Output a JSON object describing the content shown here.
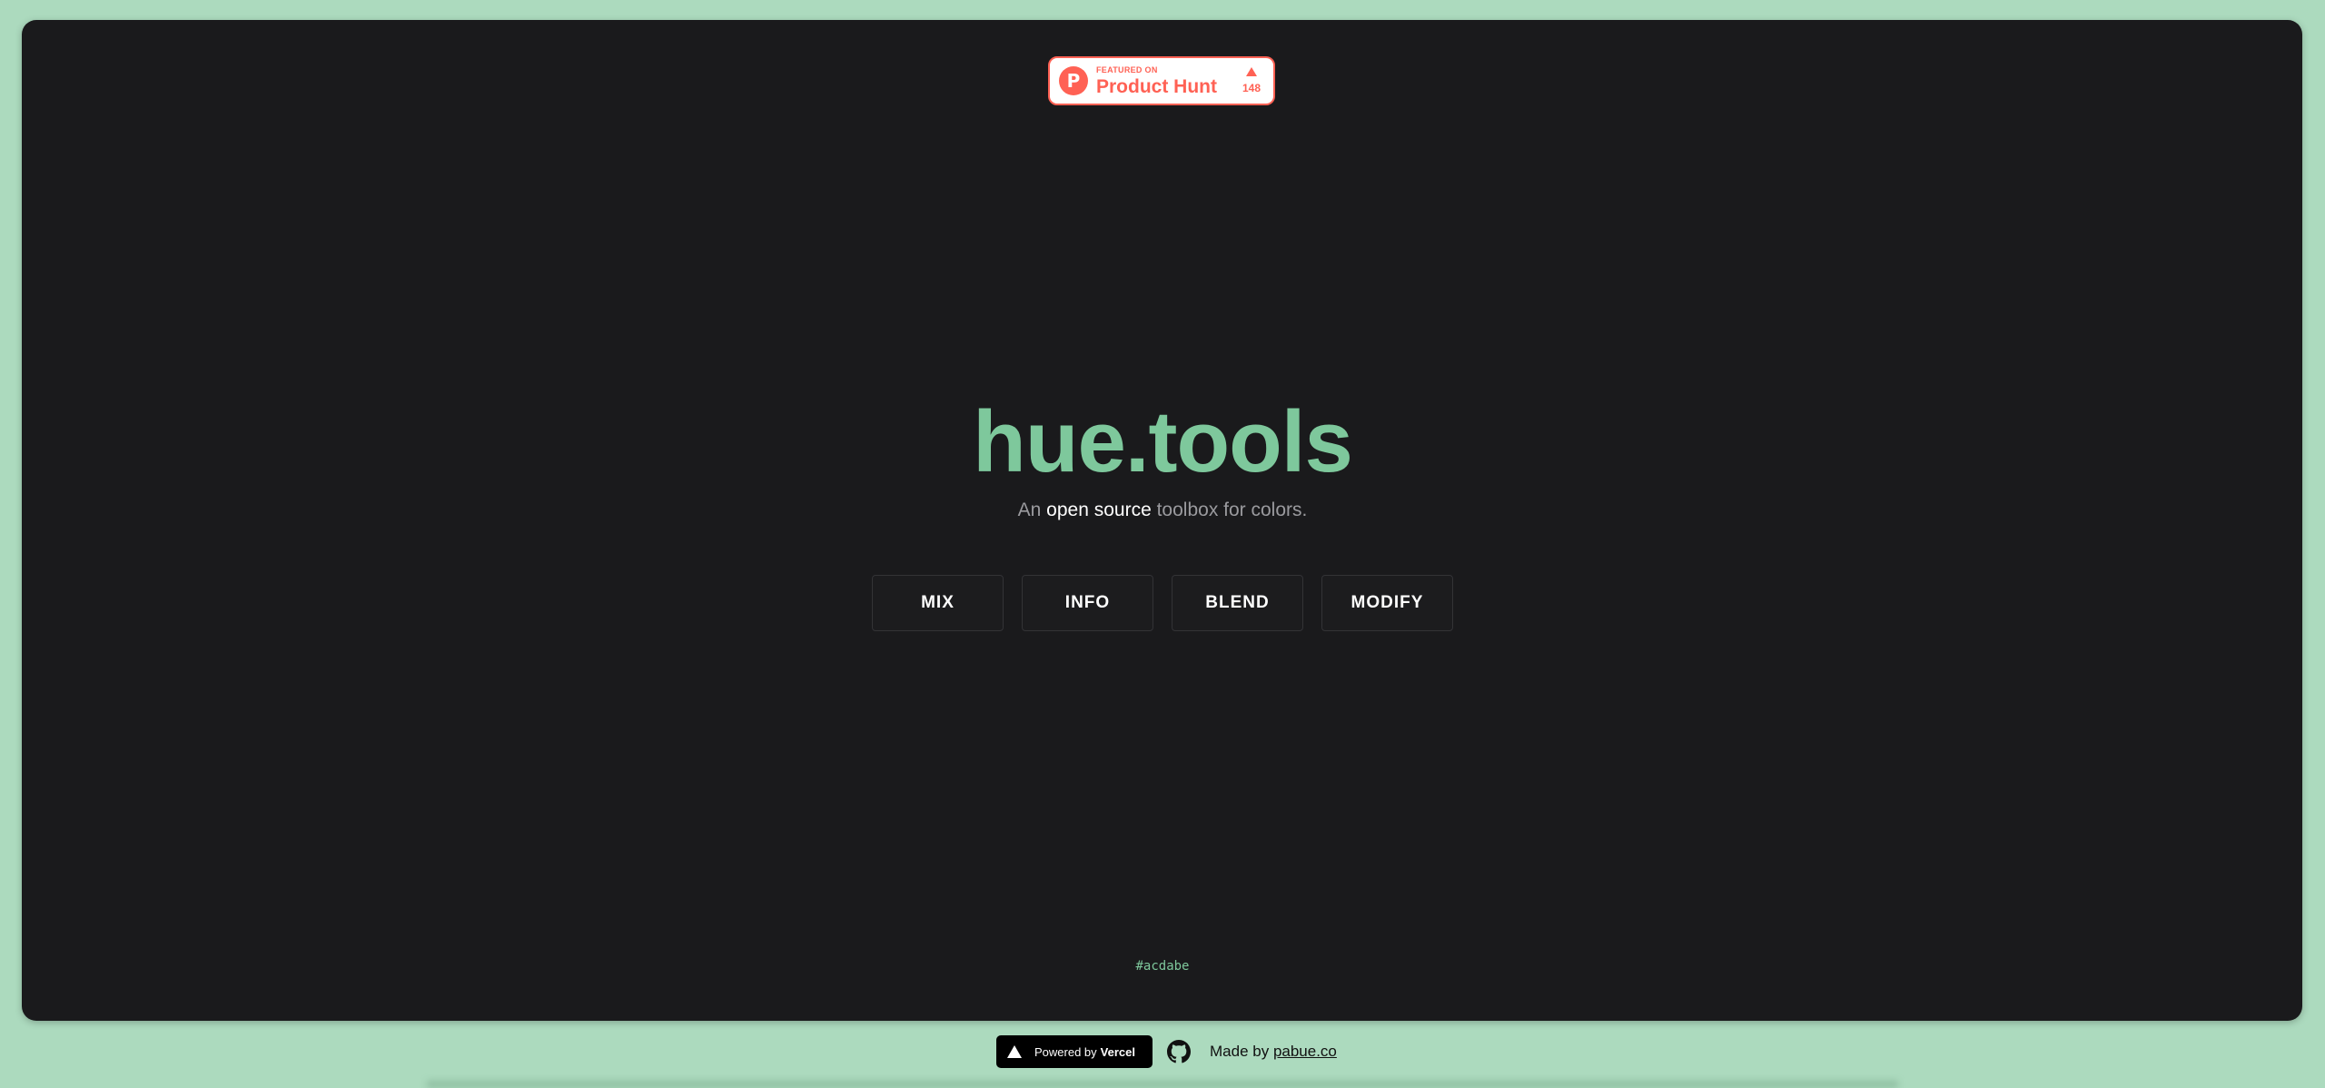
{
  "product_hunt": {
    "logo_letter": "P",
    "featured_label": "FEATURED ON",
    "name": "Product Hunt",
    "votes": "148",
    "color": "#ff6154"
  },
  "hero": {
    "title": "hue.tools",
    "tagline_before": "An ",
    "tagline_highlight": "open source",
    "tagline_after": " toolbox for colors.",
    "title_color": "#7ec89c"
  },
  "nav": {
    "items": [
      {
        "label": "MIX"
      },
      {
        "label": "INFO"
      },
      {
        "label": "BLEND"
      },
      {
        "label": "MODIFY"
      }
    ]
  },
  "current_color": {
    "hex": "#acdabe"
  },
  "footer": {
    "vercel_prefix": "Powered by",
    "vercel_brand": "Vercel",
    "made_by_prefix": "Made by",
    "made_by_link": "pabue.co",
    "icon": "github-icon"
  },
  "colors": {
    "background": "#acdabe",
    "panel": "#1a1a1c",
    "accent": "#7ec89c"
  }
}
